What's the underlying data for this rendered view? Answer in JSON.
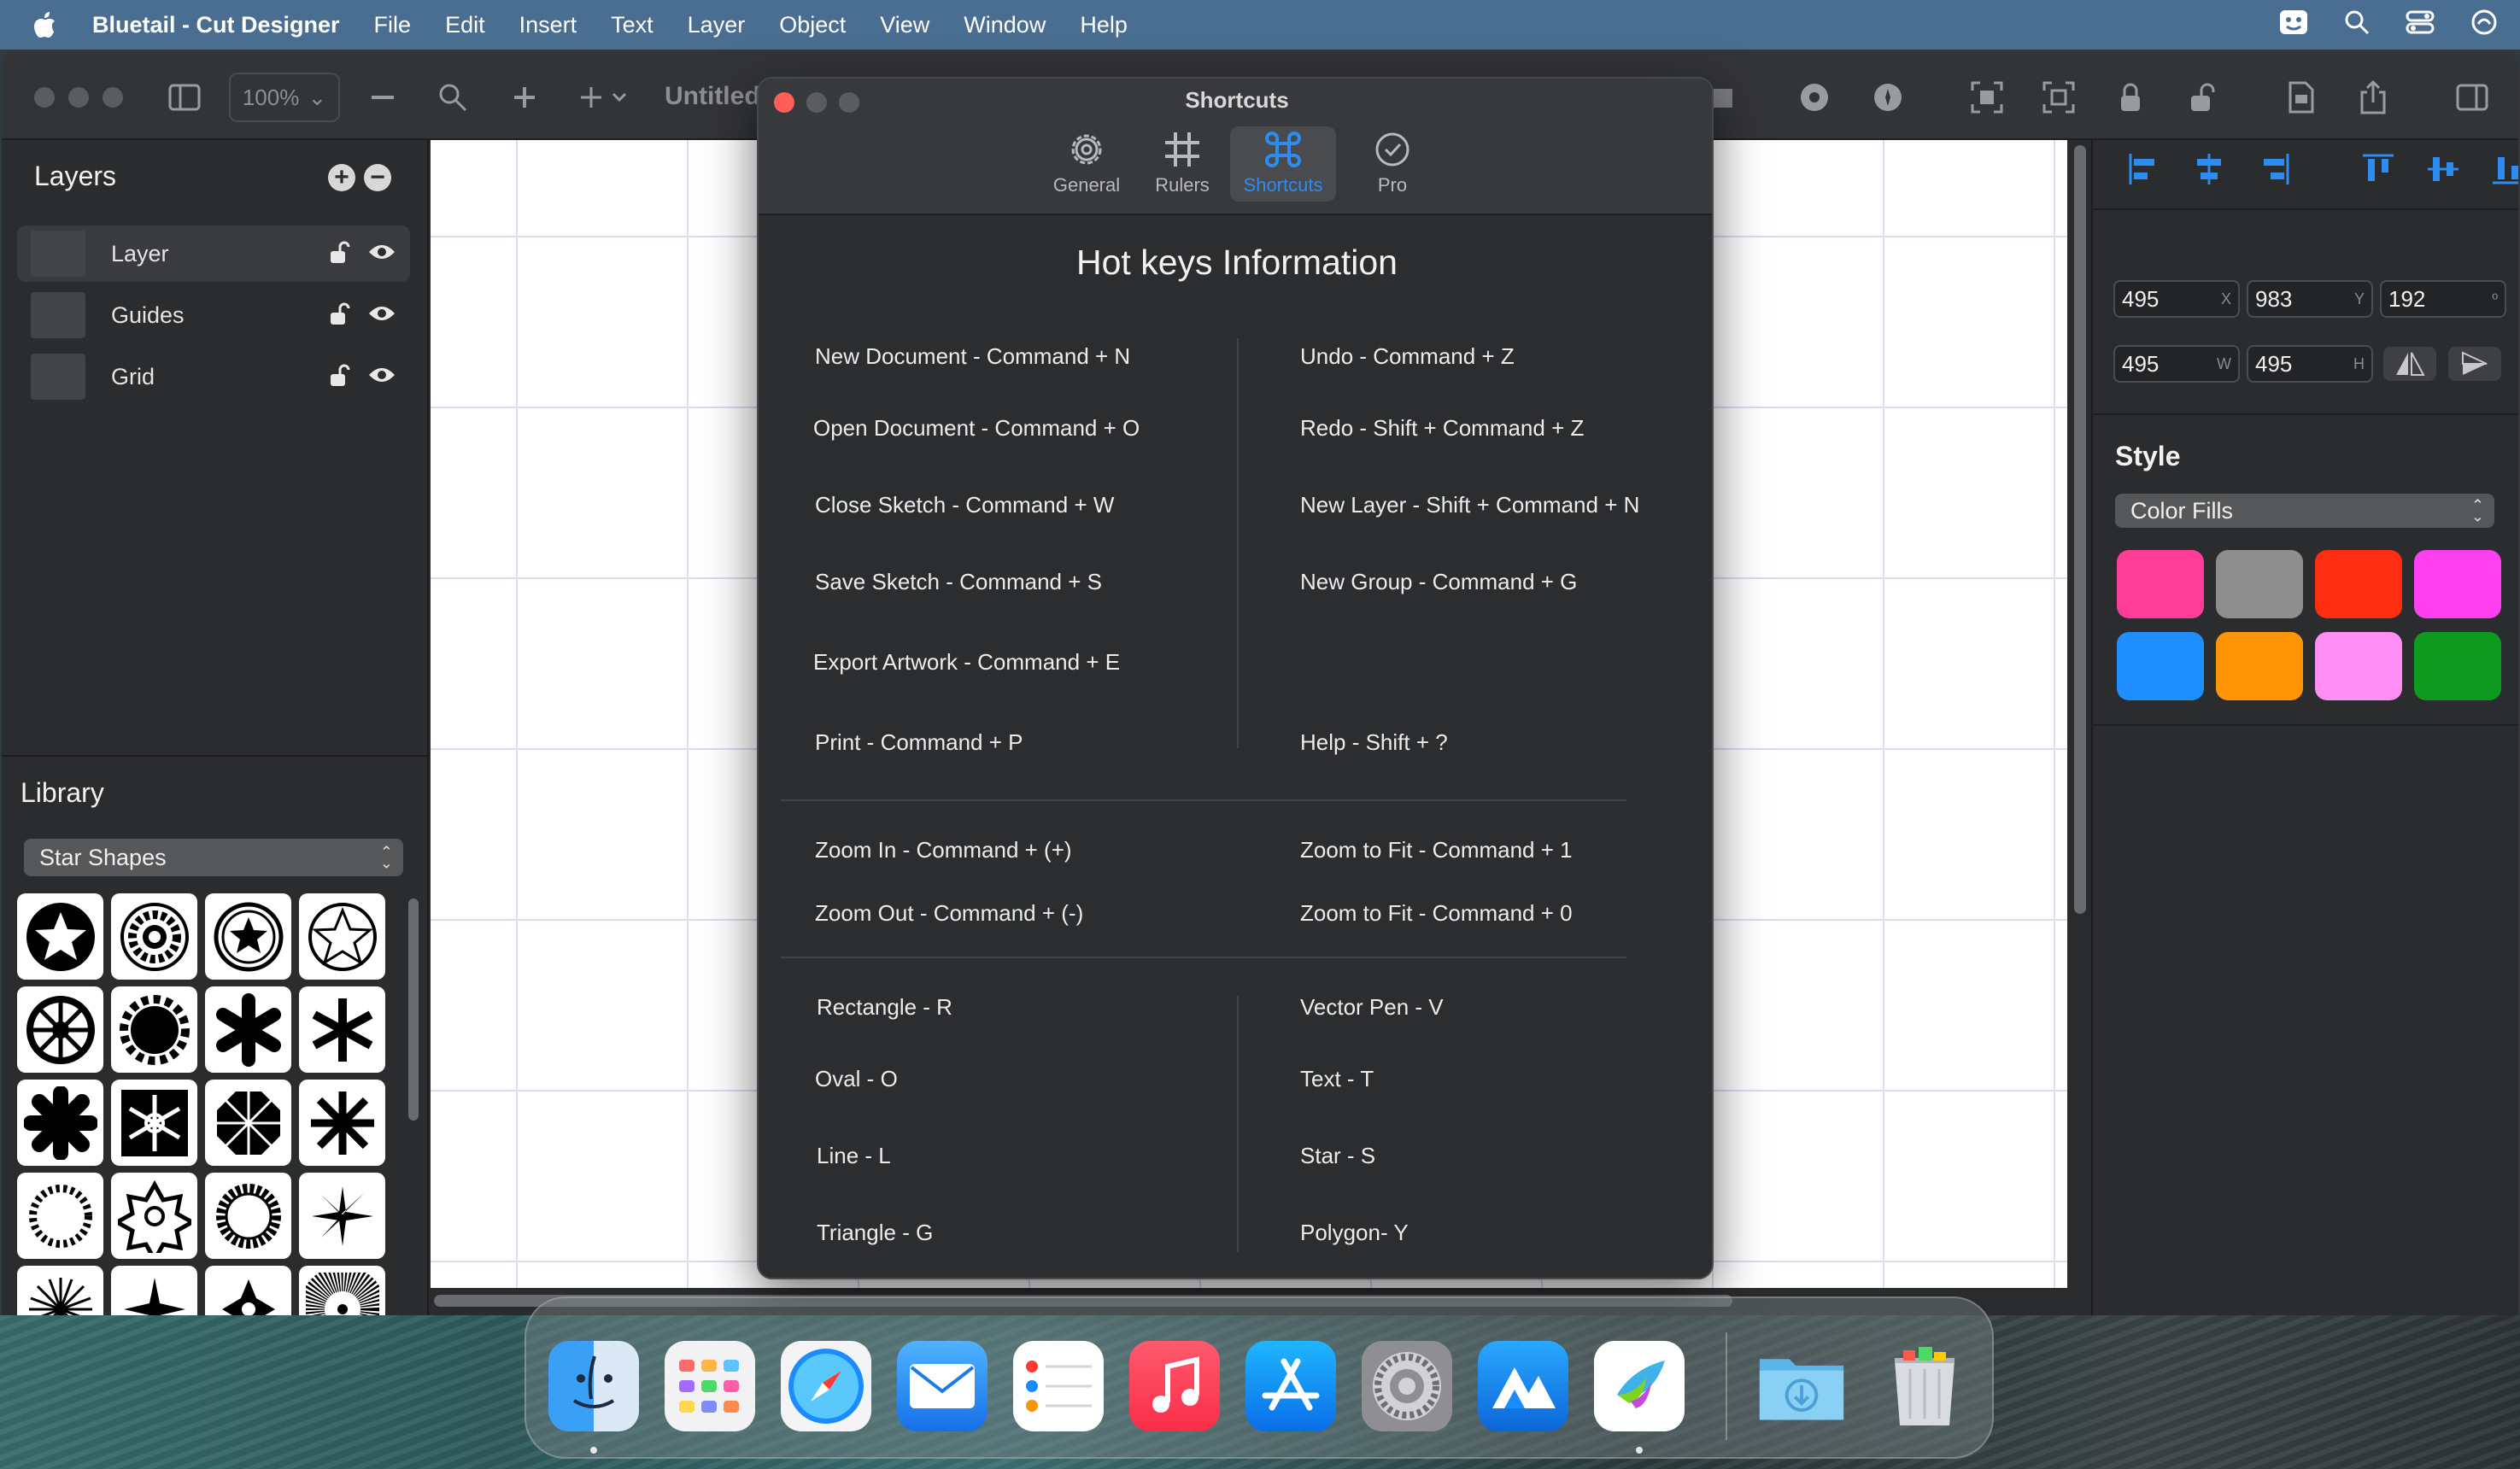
{
  "menubar": {
    "app_name": "Bluetail - Cut Designer",
    "items": [
      "File",
      "Edit",
      "Insert",
      "Text",
      "Layer",
      "Object",
      "View",
      "Window",
      "Help"
    ]
  },
  "toolbar": {
    "zoom": "100%",
    "document_title": "Untitled"
  },
  "layers_panel": {
    "title": "Layers",
    "items": [
      {
        "label": "Layer",
        "selected": true
      },
      {
        "label": "Guides",
        "selected": false
      },
      {
        "label": "Grid",
        "selected": false
      }
    ]
  },
  "library_panel": {
    "title": "Library",
    "category": "Star Shapes"
  },
  "inspector": {
    "x": "495",
    "x_unit": "X",
    "y": "983",
    "y_unit": "Y",
    "rotation": "192",
    "rotation_unit": "º",
    "w": "495",
    "w_unit": "W",
    "h": "495",
    "h_unit": "H",
    "style_title": "Style",
    "fill_mode": "Color Fills",
    "swatches": [
      "#ff3d96",
      "#8e8e8e",
      "#ff2d12",
      "#ff40f0",
      "#1f8fff",
      "#ff9406",
      "#ff8ef5",
      "#0e9a1e"
    ]
  },
  "dialog": {
    "title": "Shortcuts",
    "tabs": [
      {
        "label": "General",
        "icon": "gear-icon"
      },
      {
        "label": "Rulers",
        "icon": "grid-icon"
      },
      {
        "label": "Shortcuts",
        "icon": "command-icon",
        "active": true
      },
      {
        "label": "Pro",
        "icon": "checkmark-circle-icon"
      }
    ],
    "heading": "Hot keys Information",
    "group1_left": [
      "New Document - Command + N",
      "Open Document - Command + O",
      "Close Sketch - Command + W",
      "Save Sketch - Command + S",
      "Export Artwork - Command + E",
      "Print - Command + P"
    ],
    "group1_right": [
      "Undo - Command + Z",
      "Redo - Shift + Command + Z",
      "New Layer - Shift + Command + N",
      "New Group - Command + G",
      "Help - Shift + ?"
    ],
    "group2_left": [
      "Zoom In - Command + (+)",
      "Zoom Out - Command + (-)"
    ],
    "group2_right": [
      "Zoom to Fit - Command + 1",
      "Zoom to Fit - Command + 0"
    ],
    "group3_left": [
      "Rectangle - R",
      "Oval - O",
      "Line - L",
      "Triangle - G"
    ],
    "group3_right": [
      "Vector Pen - V",
      "Text - T",
      "Star - S",
      "Polygon- Y"
    ]
  },
  "dock": {
    "apps": [
      "finder-icon",
      "launchpad-icon",
      "safari-icon",
      "mail-icon",
      "reminders-icon",
      "music-icon",
      "app-store-icon",
      "system-settings-icon",
      "bluetail-peaks-icon",
      "bluetail-bird-icon",
      "downloads-folder-icon",
      "trash-icon"
    ]
  }
}
